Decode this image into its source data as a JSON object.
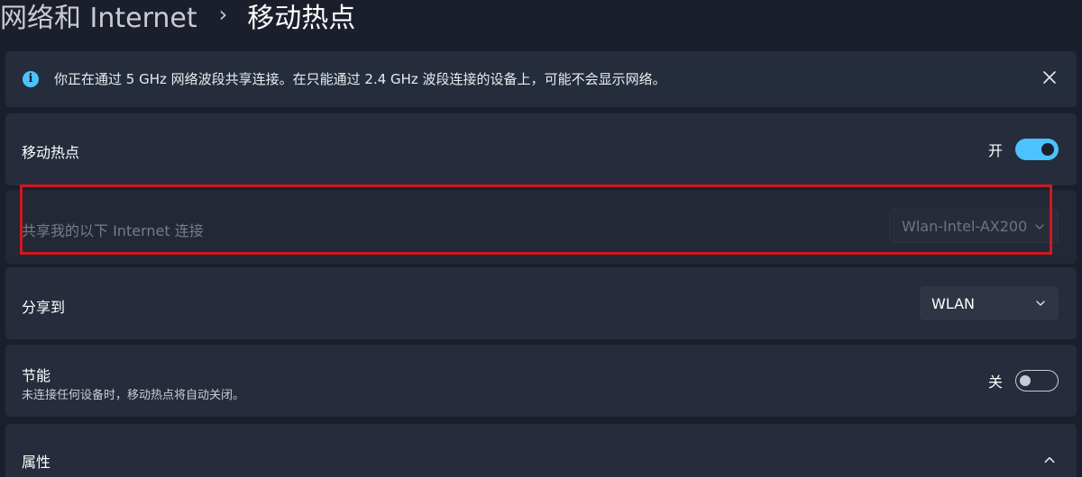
{
  "breadcrumb": {
    "parent": "网络和 Internet",
    "separator": "›",
    "current": "移动热点"
  },
  "info_bar": {
    "icon": "info-icon",
    "icon_glyph": "i",
    "message": "你正在通过 5 GHz 网络波段共享连接。在只能通过 2.4 GHz 波段连接的设备上，可能不会显示网络。",
    "close_icon": "close-icon"
  },
  "mobile_hotspot": {
    "label": "移动热点",
    "state_label": "开",
    "enabled": true
  },
  "share_from": {
    "label": "共享我的以下 Internet 连接",
    "selected": "Wlan-Intel-AX200",
    "disabled": true
  },
  "share_to": {
    "label": "分享到",
    "selected": "WLAN"
  },
  "power_saving": {
    "label": "节能",
    "description": "未连接任何设备时，移动热点将自动关闭。",
    "state_label": "关",
    "enabled": false
  },
  "properties": {
    "label": "属性",
    "expanded": true
  },
  "colors": {
    "accent": "#4cc2ff",
    "background": "#1b1f2b",
    "card": "#262c3b",
    "highlight": "#d0191d"
  }
}
